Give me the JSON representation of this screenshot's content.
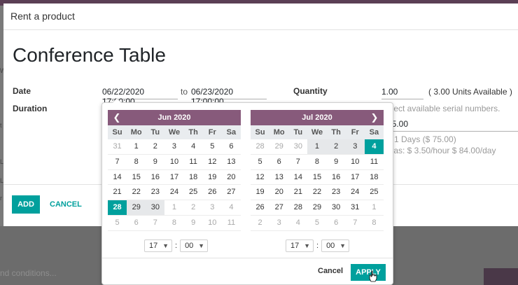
{
  "dialog": {
    "title": "Rent a product",
    "product_name": "Conference Table",
    "date_label": "Date",
    "duration_label": "Duration",
    "start_date": "06/22/2020 17:00:00",
    "to_label": "to",
    "end_date": "06/23/2020 17:00:00",
    "quantity_label": "Quantity",
    "quantity_value": "1.00",
    "units_available": "( 3.00 Units Available )",
    "serial_hint": "elect available serial numbers.",
    "price_value": "75.00",
    "pricing_line": "* 1 Days ($ 75.00)",
    "extras_line": "tras: $ 3.50/hour $ 84.00/day",
    "add_label": "ADD",
    "cancel_label": "CANCEL"
  },
  "background": {
    "terms_text": "nd conditions...",
    "left_letters": [
      "W",
      "L",
      "L",
      "t",
      "r"
    ]
  },
  "picker": {
    "dow": [
      "Su",
      "Mo",
      "Tu",
      "We",
      "Th",
      "Fr",
      "Sa"
    ],
    "left": {
      "month": "Jun 2020",
      "weeks": [
        [
          {
            "d": "31",
            "s": "off"
          },
          {
            "d": "1",
            "s": ""
          },
          {
            "d": "2",
            "s": ""
          },
          {
            "d": "3",
            "s": ""
          },
          {
            "d": "4",
            "s": ""
          },
          {
            "d": "5",
            "s": ""
          },
          {
            "d": "6",
            "s": ""
          }
        ],
        [
          {
            "d": "7",
            "s": ""
          },
          {
            "d": "8",
            "s": ""
          },
          {
            "d": "9",
            "s": ""
          },
          {
            "d": "10",
            "s": ""
          },
          {
            "d": "11",
            "s": ""
          },
          {
            "d": "12",
            "s": ""
          },
          {
            "d": "13",
            "s": ""
          }
        ],
        [
          {
            "d": "14",
            "s": ""
          },
          {
            "d": "15",
            "s": ""
          },
          {
            "d": "16",
            "s": ""
          },
          {
            "d": "17",
            "s": ""
          },
          {
            "d": "18",
            "s": ""
          },
          {
            "d": "19",
            "s": ""
          },
          {
            "d": "20",
            "s": ""
          }
        ],
        [
          {
            "d": "21",
            "s": ""
          },
          {
            "d": "22",
            "s": ""
          },
          {
            "d": "23",
            "s": ""
          },
          {
            "d": "24",
            "s": ""
          },
          {
            "d": "25",
            "s": ""
          },
          {
            "d": "26",
            "s": ""
          },
          {
            "d": "27",
            "s": ""
          }
        ],
        [
          {
            "d": "28",
            "s": "active"
          },
          {
            "d": "29",
            "s": "inrange"
          },
          {
            "d": "30",
            "s": "inrange"
          },
          {
            "d": "1",
            "s": "off"
          },
          {
            "d": "2",
            "s": "off"
          },
          {
            "d": "3",
            "s": "off"
          },
          {
            "d": "4",
            "s": "off"
          }
        ],
        [
          {
            "d": "5",
            "s": "off"
          },
          {
            "d": "6",
            "s": "off"
          },
          {
            "d": "7",
            "s": "off"
          },
          {
            "d": "8",
            "s": "off"
          },
          {
            "d": "9",
            "s": "off"
          },
          {
            "d": "10",
            "s": "off"
          },
          {
            "d": "11",
            "s": "off"
          }
        ]
      ],
      "hour": "17",
      "minute": "00"
    },
    "right": {
      "month": "Jul 2020",
      "weeks": [
        [
          {
            "d": "28",
            "s": "off"
          },
          {
            "d": "29",
            "s": "off"
          },
          {
            "d": "30",
            "s": "off"
          },
          {
            "d": "1",
            "s": "inrange"
          },
          {
            "d": "2",
            "s": "inrange"
          },
          {
            "d": "3",
            "s": "inrange"
          },
          {
            "d": "4",
            "s": "active"
          }
        ],
        [
          {
            "d": "5",
            "s": ""
          },
          {
            "d": "6",
            "s": ""
          },
          {
            "d": "7",
            "s": ""
          },
          {
            "d": "8",
            "s": ""
          },
          {
            "d": "9",
            "s": ""
          },
          {
            "d": "10",
            "s": ""
          },
          {
            "d": "11",
            "s": ""
          }
        ],
        [
          {
            "d": "12",
            "s": ""
          },
          {
            "d": "13",
            "s": ""
          },
          {
            "d": "14",
            "s": ""
          },
          {
            "d": "15",
            "s": ""
          },
          {
            "d": "16",
            "s": ""
          },
          {
            "d": "17",
            "s": ""
          },
          {
            "d": "18",
            "s": ""
          }
        ],
        [
          {
            "d": "19",
            "s": ""
          },
          {
            "d": "20",
            "s": ""
          },
          {
            "d": "21",
            "s": ""
          },
          {
            "d": "22",
            "s": ""
          },
          {
            "d": "23",
            "s": ""
          },
          {
            "d": "24",
            "s": ""
          },
          {
            "d": "25",
            "s": ""
          }
        ],
        [
          {
            "d": "26",
            "s": ""
          },
          {
            "d": "27",
            "s": ""
          },
          {
            "d": "28",
            "s": ""
          },
          {
            "d": "29",
            "s": ""
          },
          {
            "d": "30",
            "s": ""
          },
          {
            "d": "31",
            "s": ""
          },
          {
            "d": "1",
            "s": "off"
          }
        ],
        [
          {
            "d": "2",
            "s": "off"
          },
          {
            "d": "3",
            "s": "off"
          },
          {
            "d": "4",
            "s": "off"
          },
          {
            "d": "5",
            "s": "off"
          },
          {
            "d": "6",
            "s": "off"
          },
          {
            "d": "7",
            "s": "off"
          },
          {
            "d": "8",
            "s": "off"
          }
        ]
      ],
      "hour": "17",
      "minute": "00"
    },
    "cancel_label": "Cancel",
    "apply_label": "APPLY"
  },
  "colors": {
    "brand": "#875a7b",
    "accent": "#00a09d"
  },
  "icons": {
    "prev": "chevron-left-icon",
    "next": "chevron-right-icon",
    "select": "chevron-down-icon",
    "cursor": "pointer-hand-icon"
  }
}
